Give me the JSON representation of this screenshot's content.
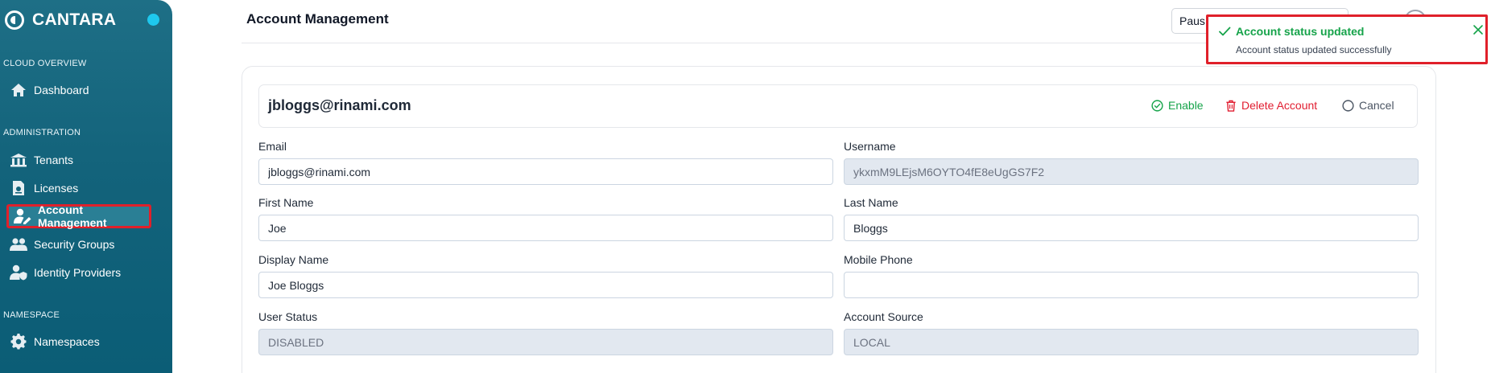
{
  "sidebar": {
    "brand": "CANTARA",
    "sections": [
      {
        "title": "CLOUD OVERVIEW"
      },
      {
        "title": "ADMINISTRATION"
      },
      {
        "title": "NAMESPACE"
      }
    ],
    "items": [
      {
        "label": "Dashboard",
        "icon": "home-icon"
      },
      {
        "label": "Tenants",
        "icon": "building-icon"
      },
      {
        "label": "Licenses",
        "icon": "license-icon"
      },
      {
        "label": "Account Management",
        "icon": "user-edit-icon",
        "active": true
      },
      {
        "label": "Security Groups",
        "icon": "users-icon"
      },
      {
        "label": "Identity Providers",
        "icon": "user-shield-icon"
      },
      {
        "label": "Namespaces",
        "icon": "gear-icon"
      }
    ]
  },
  "header": {
    "title": "Account Management",
    "pause_select": "Paus"
  },
  "account": {
    "title": "jbloggs@rinami.com",
    "actions": {
      "enable": "Enable",
      "delete": "Delete Account",
      "cancel": "Cancel"
    },
    "fields": {
      "email": {
        "label": "Email",
        "value": "jbloggs@rinami.com"
      },
      "username": {
        "label": "Username",
        "value": "ykxmM9LEjsM6OYTO4fE8eUgGS7F2"
      },
      "first_name": {
        "label": "First Name",
        "value": "Joe"
      },
      "last_name": {
        "label": "Last Name",
        "value": "Bloggs"
      },
      "display_name": {
        "label": "Display Name",
        "value": "Joe Bloggs"
      },
      "mobile_phone": {
        "label": "Mobile Phone",
        "value": ""
      },
      "user_status": {
        "label": "User Status",
        "value": "DISABLED"
      },
      "account_source": {
        "label": "Account Source",
        "value": "LOCAL"
      }
    }
  },
  "toast": {
    "title": "Account status updated",
    "message": "Account status updated successfully"
  },
  "colors": {
    "sidebar": "#13637b",
    "accent_dot": "#1ec8ee",
    "success": "#16a34a",
    "danger": "#e11d30",
    "highlight_outline": "#e0202a"
  }
}
